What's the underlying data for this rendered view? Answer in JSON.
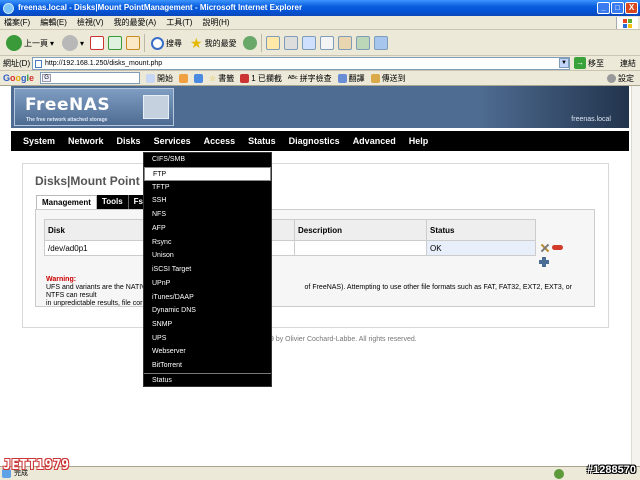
{
  "window": {
    "title": "freenas.local - Disks|Mount PointManagement - Microsoft Internet Explorer",
    "buttons": [
      "_",
      "□",
      "X"
    ]
  },
  "menubar": [
    "檔案(F)",
    "編輯(E)",
    "檢視(V)",
    "我的最愛(A)",
    "工具(T)",
    "說明(H)"
  ],
  "toolbar": {
    "back": "上一頁",
    "search": "搜尋",
    "favorites": "我的最愛"
  },
  "address": {
    "label": "網址(D)",
    "url": "http://192.168.1.250/disks_mount.php",
    "go": "移至",
    "links": "連結"
  },
  "googlebar": {
    "logo": "Google",
    "search_value": "G",
    "items": [
      "開始",
      "書籤",
      "1 已攔截",
      "拼字檢查",
      "翻譯",
      "傳送到",
      "設定"
    ]
  },
  "freenas": {
    "logo_name": "FreeNAS",
    "logo_tagline": "The free network attached storage",
    "hostname": "freenas.local",
    "nav": [
      "System",
      "Network",
      "Disks",
      "Services",
      "Access",
      "Status",
      "Diagnostics",
      "Advanced",
      "Help"
    ],
    "page_title": "Disks|Mount Point",
    "tabs": [
      "Management",
      "Tools",
      "Fsck"
    ],
    "table": {
      "headers": [
        "Disk",
        "Description",
        "Status"
      ],
      "rows": [
        {
          "disk": "/dev/ad0p1",
          "description": "",
          "status": "OK"
        }
      ]
    },
    "warning_title": "Warning:",
    "warning_line1_start": "UFS and variants are the NATIVE",
    "warning_line1_end": "of FreeNAS). Attempting to use other file formats such as FAT, FAT32, EXT2, EXT3, or NTFS can result",
    "warning_line2": "in unpredictable results, file corru",
    "footer": "9 by Olivier Cochard-Labbe. All rights reserved."
  },
  "services_menu": {
    "items": [
      "CIFS/SMB",
      "FTP",
      "TFTP",
      "SSH",
      "NFS",
      "AFP",
      "Rsync",
      "Unison",
      "iSCSI Target",
      "UPnP",
      "iTunes/DAAP",
      "Dynamic DNS",
      "SNMP",
      "UPS",
      "Webserver",
      "BitTorrent"
    ],
    "status": "Status",
    "active_index": 1
  },
  "statusbar": {
    "text": "完成"
  },
  "watermarks": {
    "left": "JETT1979",
    "right": "#1288570"
  }
}
